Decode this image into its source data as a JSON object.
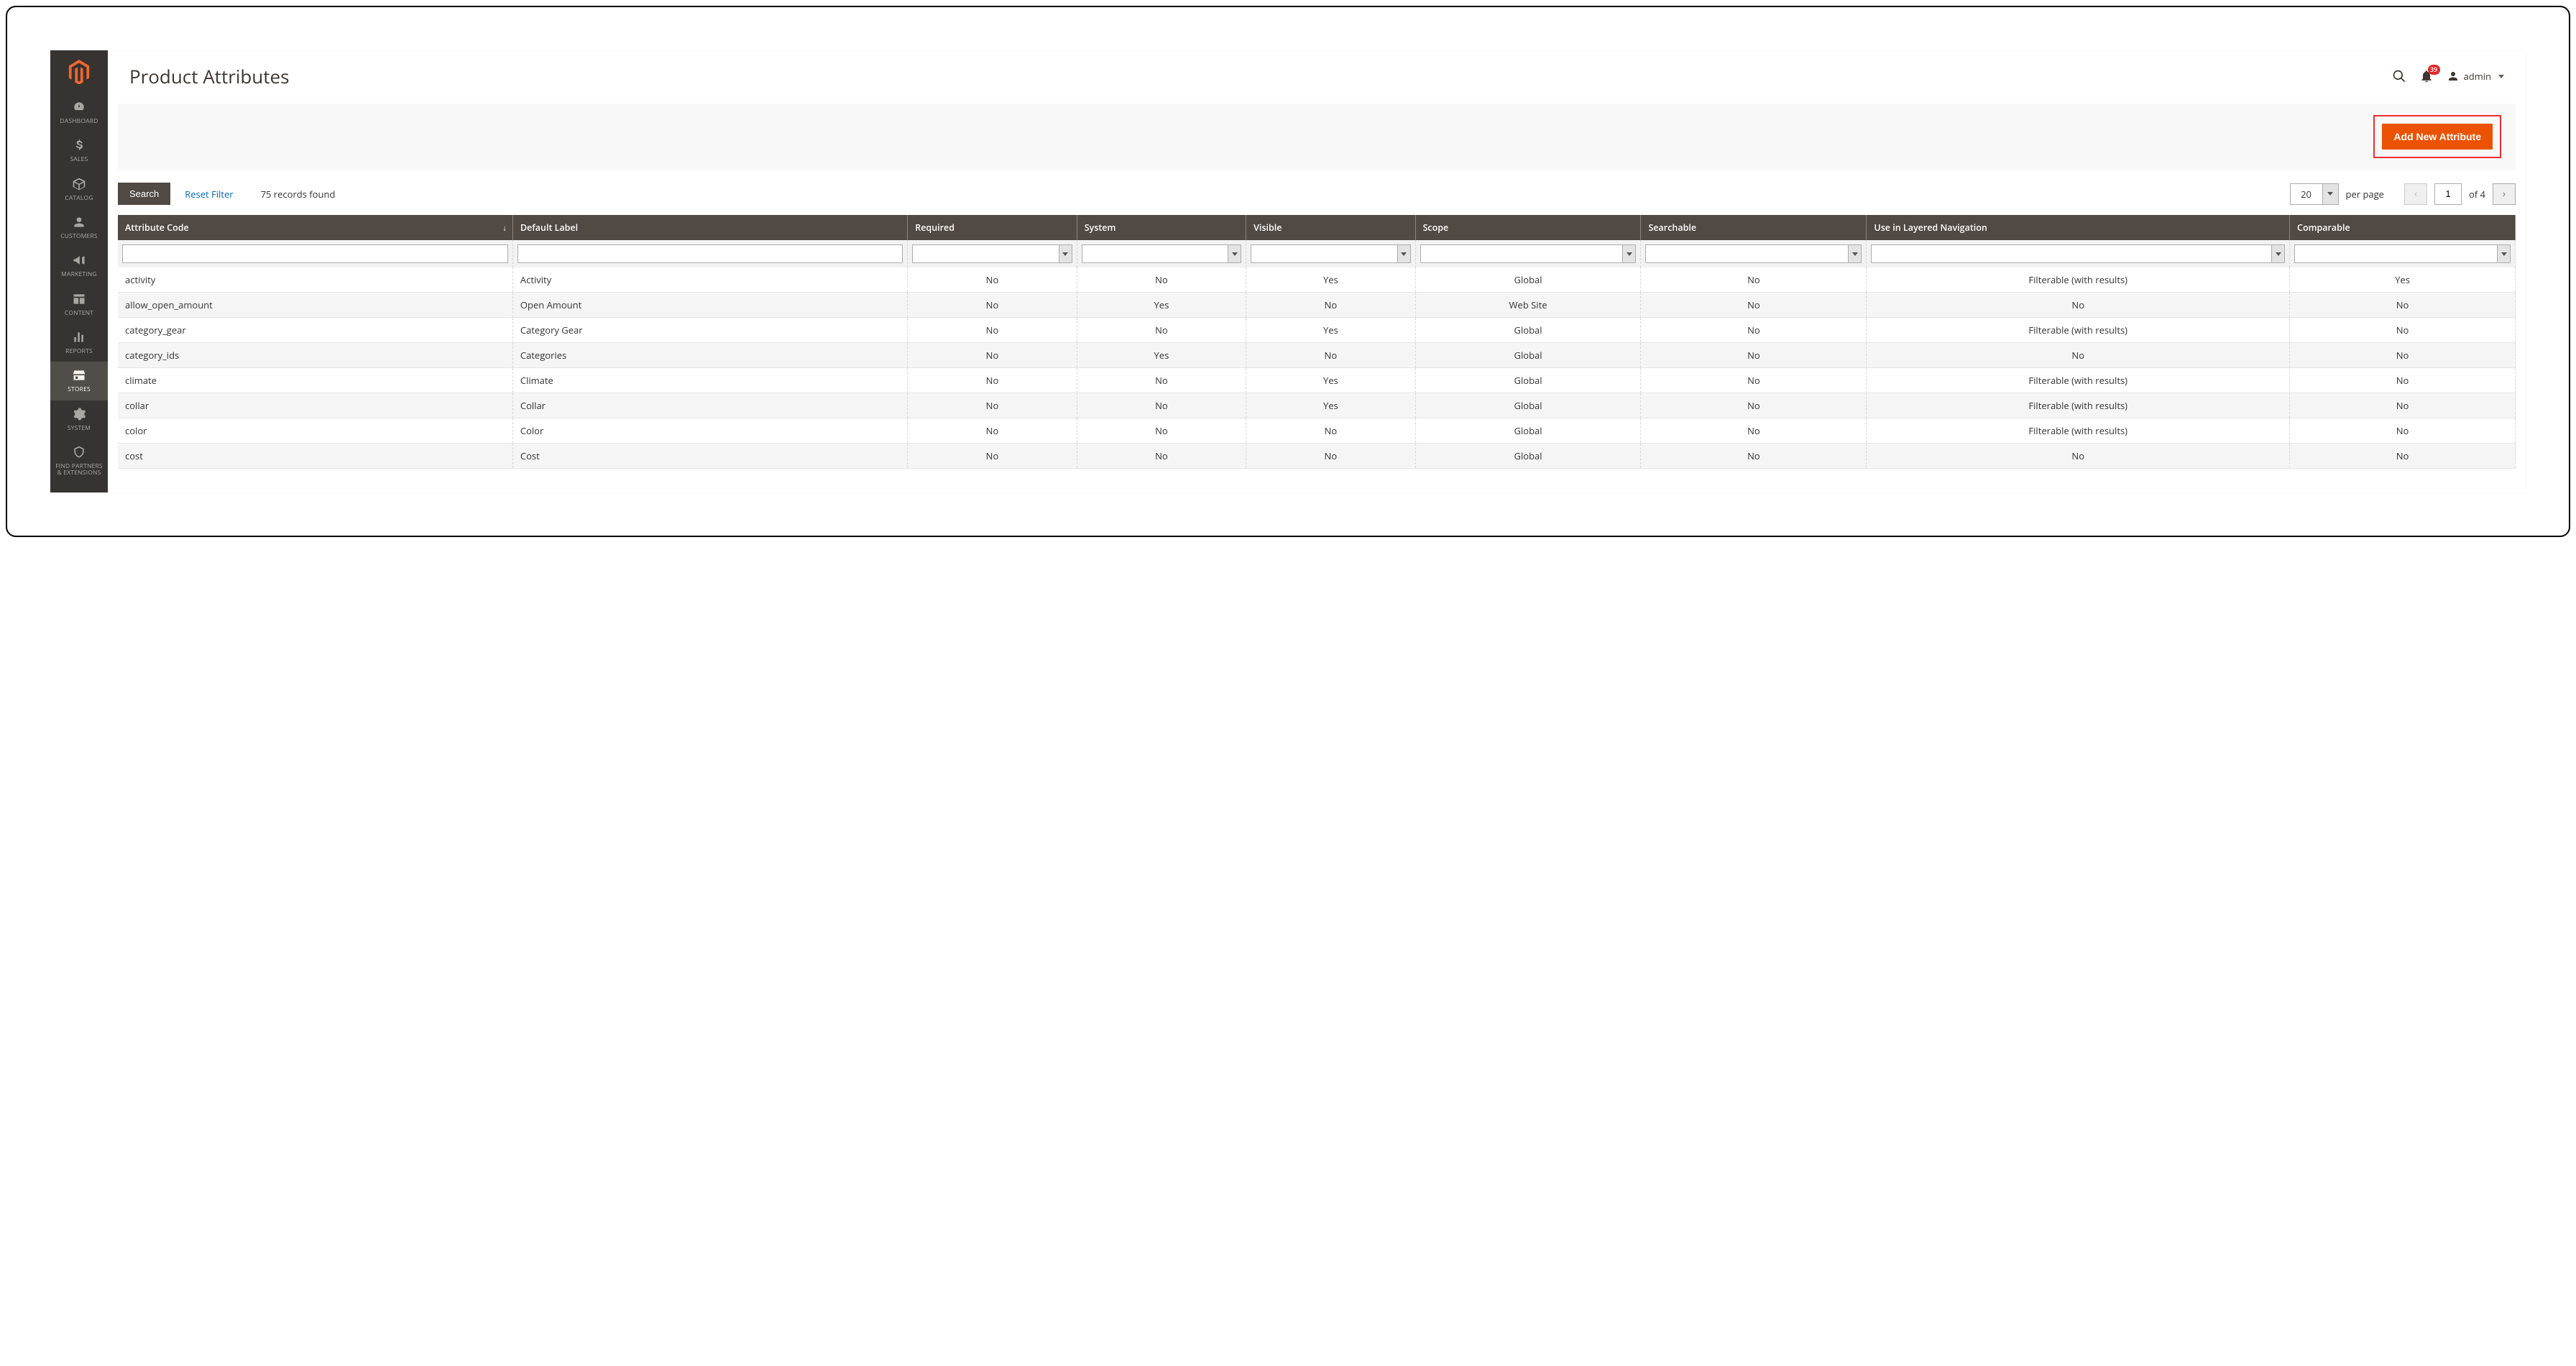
{
  "page": {
    "title": "Product Attributes",
    "user": "admin",
    "notifications_count": "39"
  },
  "sidebar": {
    "items": [
      {
        "label": "DASHBOARD"
      },
      {
        "label": "SALES"
      },
      {
        "label": "CATALOG"
      },
      {
        "label": "CUSTOMERS"
      },
      {
        "label": "MARKETING"
      },
      {
        "label": "CONTENT"
      },
      {
        "label": "REPORTS"
      },
      {
        "label": "STORES"
      },
      {
        "label": "SYSTEM"
      },
      {
        "label": "FIND PARTNERS & EXTENSIONS"
      }
    ]
  },
  "actions": {
    "add_new_attribute": "Add New Attribute"
  },
  "toolbar": {
    "search": "Search",
    "reset": "Reset Filter",
    "records": "75 records found",
    "per_page_value": "20",
    "per_page_label": "per page",
    "page_value": "1",
    "page_of": "of 4"
  },
  "grid": {
    "columns": [
      {
        "label": "Attribute Code"
      },
      {
        "label": "Default Label"
      },
      {
        "label": "Required"
      },
      {
        "label": "System"
      },
      {
        "label": "Visible"
      },
      {
        "label": "Scope"
      },
      {
        "label": "Searchable"
      },
      {
        "label": "Use in Layered Navigation"
      },
      {
        "label": "Comparable"
      }
    ],
    "rows": [
      {
        "code": "activity",
        "label": "Activity",
        "required": "No",
        "system": "No",
        "visible": "Yes",
        "scope": "Global",
        "searchable": "No",
        "layered": "Filterable (with results)",
        "comparable": "Yes"
      },
      {
        "code": "allow_open_amount",
        "label": "Open Amount",
        "required": "No",
        "system": "Yes",
        "visible": "No",
        "scope": "Web Site",
        "searchable": "No",
        "layered": "No",
        "comparable": "No"
      },
      {
        "code": "category_gear",
        "label": "Category Gear",
        "required": "No",
        "system": "No",
        "visible": "Yes",
        "scope": "Global",
        "searchable": "No",
        "layered": "Filterable (with results)",
        "comparable": "No"
      },
      {
        "code": "category_ids",
        "label": "Categories",
        "required": "No",
        "system": "Yes",
        "visible": "No",
        "scope": "Global",
        "searchable": "No",
        "layered": "No",
        "comparable": "No"
      },
      {
        "code": "climate",
        "label": "Climate",
        "required": "No",
        "system": "No",
        "visible": "Yes",
        "scope": "Global",
        "searchable": "No",
        "layered": "Filterable (with results)",
        "comparable": "No"
      },
      {
        "code": "collar",
        "label": "Collar",
        "required": "No",
        "system": "No",
        "visible": "Yes",
        "scope": "Global",
        "searchable": "No",
        "layered": "Filterable (with results)",
        "comparable": "No"
      },
      {
        "code": "color",
        "label": "Color",
        "required": "No",
        "system": "No",
        "visible": "No",
        "scope": "Global",
        "searchable": "No",
        "layered": "Filterable (with results)",
        "comparable": "No"
      },
      {
        "code": "cost",
        "label": "Cost",
        "required": "No",
        "system": "No",
        "visible": "No",
        "scope": "Global",
        "searchable": "No",
        "layered": "No",
        "comparable": "No"
      }
    ]
  }
}
